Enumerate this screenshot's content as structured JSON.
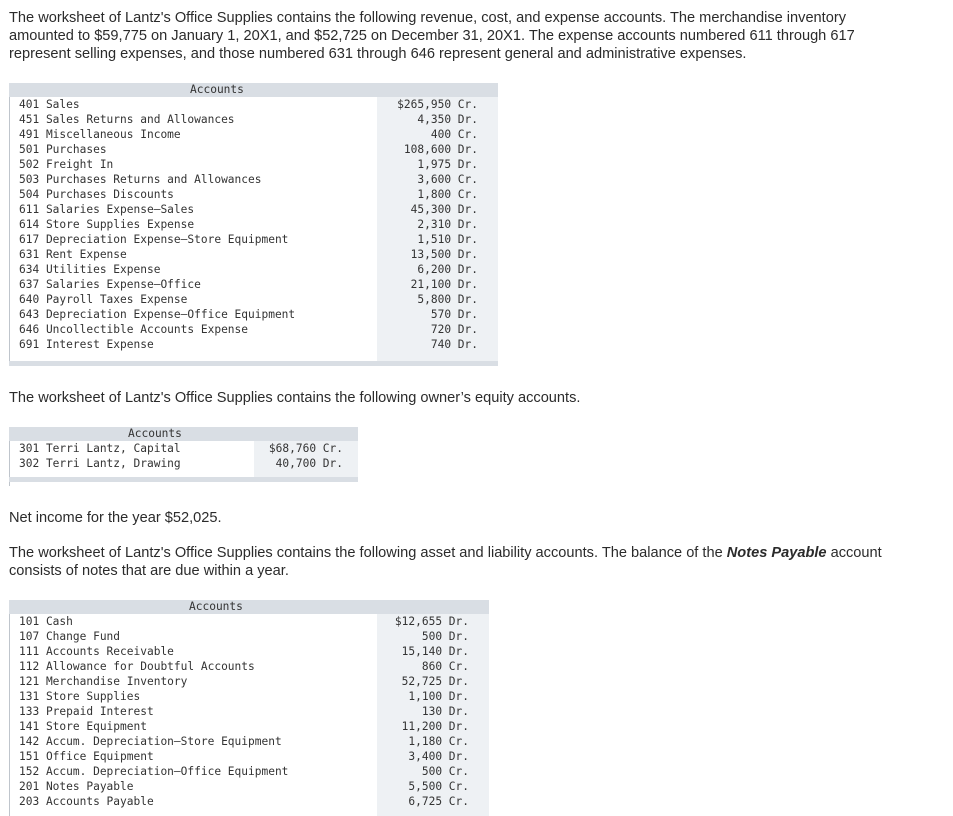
{
  "intro": {
    "line1": "The worksheet of Lantz's Office Supplies contains the following revenue, cost, and expense accounts. The merchandise inventory",
    "line2": "amounted to $59,775 on January 1, 20X1, and $52,725 on December 31, 20X1. The expense accounts numbered 611 through 617",
    "line3": "represent selling expenses, and those numbered 631 through 646 represent general and administrative expenses."
  },
  "table1": {
    "header": "Accounts",
    "rows": [
      {
        "account": "401 Sales",
        "amount": "$265,950 Cr."
      },
      {
        "account": "451 Sales Returns and Allowances",
        "amount": "4,350 Dr."
      },
      {
        "account": "491 Miscellaneous Income",
        "amount": "400 Cr."
      },
      {
        "account": "501 Purchases",
        "amount": "108,600 Dr."
      },
      {
        "account": "502 Freight In",
        "amount": "1,975 Dr."
      },
      {
        "account": "503 Purchases Returns and Allowances",
        "amount": "3,600 Cr."
      },
      {
        "account": "504 Purchases Discounts",
        "amount": "1,800 Cr."
      },
      {
        "account": "611 Salaries Expense—Sales",
        "amount": "45,300 Dr."
      },
      {
        "account": "614 Store Supplies Expense",
        "amount": "2,310 Dr."
      },
      {
        "account": "617 Depreciation Expense—Store Equipment",
        "amount": "1,510 Dr."
      },
      {
        "account": "631 Rent Expense",
        "amount": "13,500 Dr."
      },
      {
        "account": "634 Utilities Expense",
        "amount": "6,200 Dr."
      },
      {
        "account": "637 Salaries Expense—Office",
        "amount": "21,100 Dr."
      },
      {
        "account": "640 Payroll Taxes Expense",
        "amount": "5,800 Dr."
      },
      {
        "account": "643 Depreciation Expense—Office Equipment",
        "amount": "570 Dr."
      },
      {
        "account": "646 Uncollectible Accounts Expense",
        "amount": "720 Dr."
      },
      {
        "account": "691 Interest Expense",
        "amount": "740 Dr."
      }
    ]
  },
  "equity_intro": "The worksheet of Lantz's Office Supplies contains the following owner’s equity accounts.",
  "table2": {
    "header": "Accounts",
    "rows": [
      {
        "account": "301 Terri Lantz, Capital",
        "amount": "$68,760 Cr."
      },
      {
        "account": "302 Terri Lantz, Drawing",
        "amount": "40,700 Dr."
      }
    ]
  },
  "net_income": "Net income for the year $52,025.",
  "asset_intro": {
    "part1": "The worksheet of Lantz's Office Supplies contains the following asset and liability accounts. The balance of the ",
    "bold": "Notes Payable",
    "part2": " account",
    "line2": "consists of notes that are due within a year."
  },
  "table3": {
    "header": "Accounts",
    "rows": [
      {
        "account": "101 Cash",
        "amount": "$12,655 Dr."
      },
      {
        "account": "107 Change Fund",
        "amount": "500 Dr."
      },
      {
        "account": "111 Accounts Receivable",
        "amount": "15,140 Dr."
      },
      {
        "account": "112 Allowance for Doubtful Accounts",
        "amount": "860 Cr."
      },
      {
        "account": "121 Merchandise Inventory",
        "amount": "52,725 Dr."
      },
      {
        "account": "131 Store Supplies",
        "amount": "1,100 Dr."
      },
      {
        "account": "133 Prepaid Interest",
        "amount": "130 Dr."
      },
      {
        "account": "141 Store Equipment",
        "amount": "11,200 Dr."
      },
      {
        "account": "142 Accum. Depreciation—Store Equipment",
        "amount": "1,180 Cr."
      },
      {
        "account": "151 Office Equipment",
        "amount": "3,400 Dr."
      },
      {
        "account": "152 Accum. Depreciation—Office Equipment",
        "amount": "500 Cr."
      },
      {
        "account": "201 Notes Payable",
        "amount": "5,500 Cr."
      },
      {
        "account": "203 Accounts Payable",
        "amount": "6,725 Cr."
      }
    ]
  },
  "colors": {
    "header_bg": "#d9dee4",
    "text": "#2b2b2b"
  }
}
